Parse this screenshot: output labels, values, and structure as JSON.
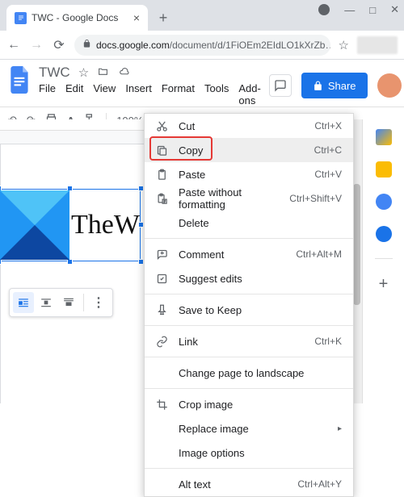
{
  "browser": {
    "tab_title": "TWC - Google Docs",
    "url_host": "docs.google.com",
    "url_path": "/document/d/1FiOEm2EIdLO1kXrZb…"
  },
  "docs": {
    "title": "TWC",
    "menus": [
      "File",
      "Edit",
      "View",
      "Insert",
      "Format",
      "Tools",
      "Add-ons"
    ],
    "zoom": "100%",
    "share_label": "Share",
    "logo_text": "TheW"
  },
  "context_menu": {
    "items": [
      {
        "icon": "cut-icon",
        "label": "Cut",
        "shortcut": "Ctrl+X"
      },
      {
        "icon": "copy-icon",
        "label": "Copy",
        "shortcut": "Ctrl+C",
        "highlighted": true,
        "hover": true
      },
      {
        "icon": "paste-icon",
        "label": "Paste",
        "shortcut": "Ctrl+V"
      },
      {
        "icon": "paste-plain-icon",
        "label": "Paste without formatting",
        "shortcut": "Ctrl+Shift+V"
      },
      {
        "icon": "",
        "label": "Delete",
        "shortcut": ""
      },
      {
        "sep": true
      },
      {
        "icon": "comment-icon",
        "label": "Comment",
        "shortcut": "Ctrl+Alt+M"
      },
      {
        "icon": "suggest-icon",
        "label": "Suggest edits",
        "shortcut": ""
      },
      {
        "sep": true
      },
      {
        "icon": "keep-icon",
        "label": "Save to Keep",
        "shortcut": ""
      },
      {
        "sep": true
      },
      {
        "icon": "link-icon",
        "label": "Link",
        "shortcut": "Ctrl+K"
      },
      {
        "sep": true
      },
      {
        "icon": "",
        "label": "Change page to landscape",
        "shortcut": ""
      },
      {
        "sep": true
      },
      {
        "icon": "crop-icon",
        "label": "Crop image",
        "shortcut": ""
      },
      {
        "icon": "",
        "label": "Replace image",
        "shortcut": "",
        "submenu": true
      },
      {
        "icon": "",
        "label": "Image options",
        "shortcut": ""
      },
      {
        "sep": true
      },
      {
        "icon": "",
        "label": "Alt text",
        "shortcut": "Ctrl+Alt+Y"
      }
    ]
  }
}
